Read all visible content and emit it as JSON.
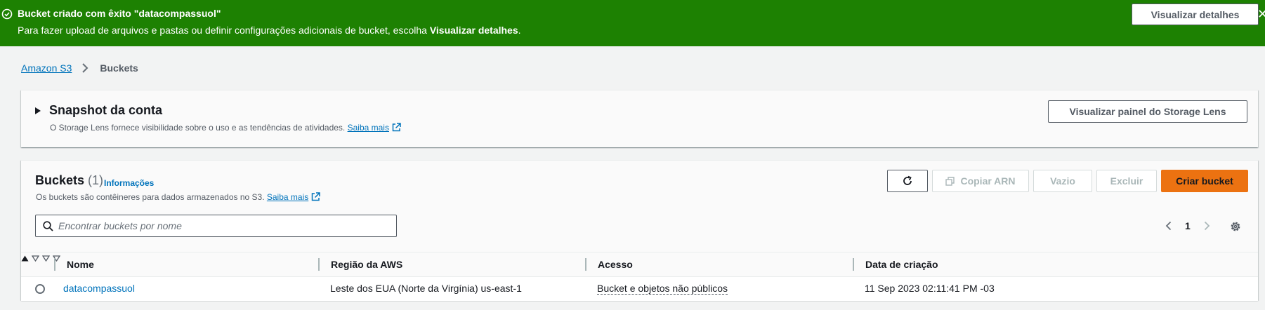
{
  "flash": {
    "title": "Bucket criado com êxito \"datacompassuol\"",
    "message_prefix": "Para fazer upload de arquivos e pastas ou definir configurações adicionais de bucket, escolha ",
    "message_bold": "Visualizar detalhes",
    "message_suffix": ".",
    "button_label": "Visualizar detalhes",
    "color": "#1d8102"
  },
  "breadcrumb": {
    "root": "Amazon S3",
    "current": "Buckets"
  },
  "snapshot": {
    "title": "Snapshot da conta",
    "description": "O Storage Lens fornece visibilidade sobre o uso e as tendências de atividades.",
    "learn_more": "Saiba mais",
    "button_label": "Visualizar painel do Storage Lens"
  },
  "buckets": {
    "title": "Buckets",
    "count": "(1)",
    "info_link": "Informações",
    "description": "Os buckets são contêineres para dados armazenados no S3.",
    "learn_more": "Saiba mais",
    "actions": {
      "copy_arn": "Copiar ARN",
      "empty": "Vazio",
      "delete": "Excluir",
      "create": "Criar bucket"
    },
    "search_placeholder": "Encontrar buckets por nome",
    "page": "1",
    "columns": [
      "Nome",
      "Região da AWS",
      "Acesso",
      "Data de criação"
    ],
    "rows": [
      {
        "name": "datacompassuol",
        "region": "Leste dos EUA (Norte da Virgínia) us-east-1",
        "access": "Bucket e objetos não públicos",
        "created": "11 Sep 2023 02:11:41 PM -03"
      }
    ]
  },
  "colors": {
    "accent": "#ec7211",
    "link": "#0073bb",
    "success": "#1d8102"
  }
}
